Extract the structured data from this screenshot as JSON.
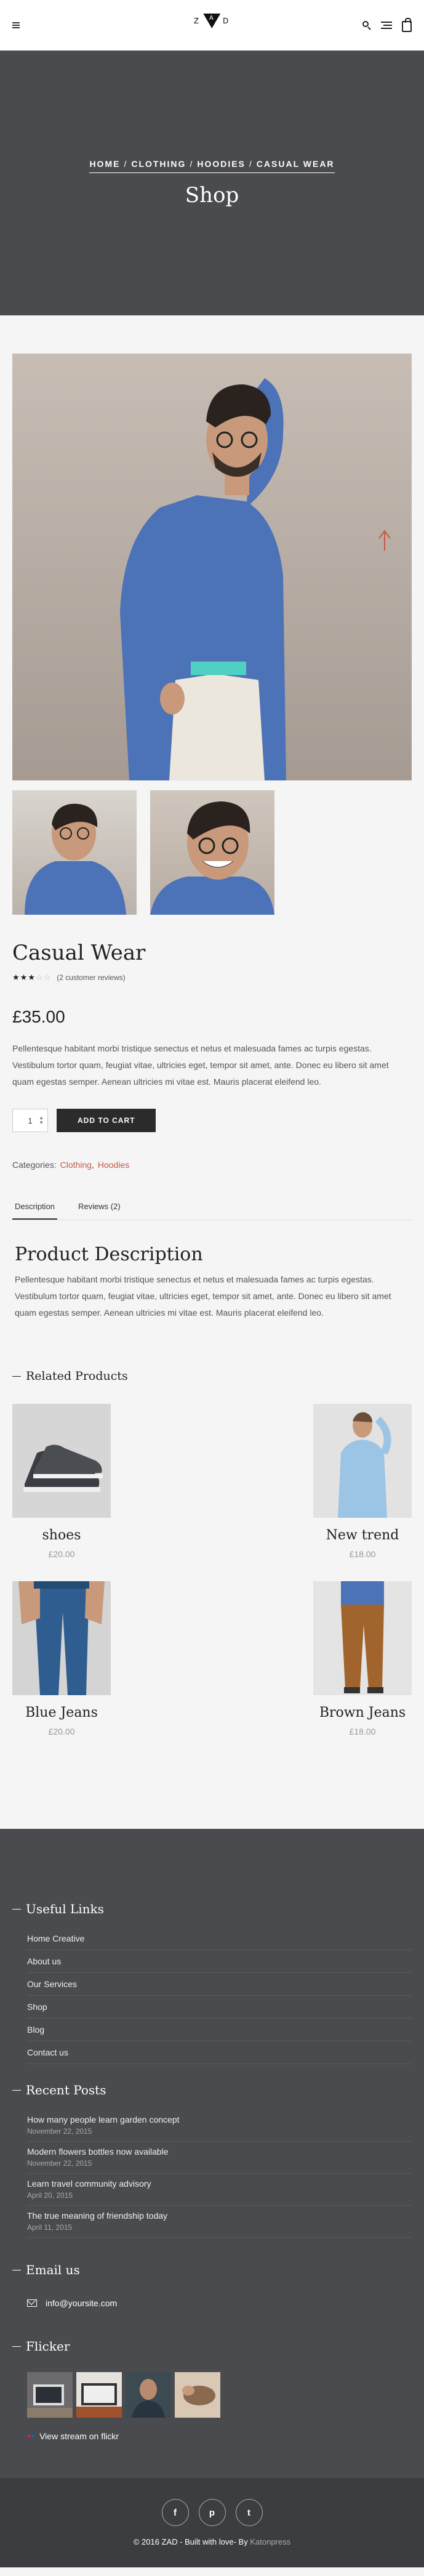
{
  "header": {
    "logo_left": "Z",
    "logo_mid": "A",
    "logo_right": "D"
  },
  "hero": {
    "breadcrumb": [
      "HOME",
      "CLOTHING",
      "HOODIES",
      "CASUAL WEAR"
    ],
    "title": "Shop"
  },
  "product": {
    "title": "Casual Wear",
    "rating": 3,
    "rating_max": 5,
    "reviews": "(2 customer reviews)",
    "price": "£35.00",
    "description": "Pellentesque habitant morbi tristique senectus et netus et malesuada fames ac turpis egestas. Vestibulum tortor quam, feugiat vitae, ultricies eget, tempor sit amet, ante. Donec eu libero sit amet quam egestas semper. Aenean ultricies mi vitae est. Mauris placerat eleifend leo.",
    "quantity": "1",
    "add_to_cart": "ADD TO CART",
    "categories_label": "Categories:",
    "categories": [
      "Clothing",
      "Hoodies"
    ],
    "tabs": [
      "Description",
      "Reviews (2)"
    ],
    "pd_title": "Product Description",
    "pd_text": "Pellentesque habitant morbi tristique senectus et netus et malesuada fames ac turpis egestas. Vestibulum tortor quam, feugiat vitae, ultricies eget, tempor sit amet, ante. Donec eu libero sit amet quam egestas semper. Aenean ultricies mi vitae est. Mauris placerat eleifend leo."
  },
  "related": {
    "title": "Related Products",
    "items": [
      {
        "name": "shoes",
        "price": "£20.00"
      },
      {
        "name": "New trend",
        "price": "£18.00"
      },
      {
        "name": "Blue Jeans",
        "price": "£20.00"
      },
      {
        "name": "Brown Jeans",
        "price": "£18.00"
      }
    ]
  },
  "footer": {
    "useful_links_title": "Useful Links",
    "links": [
      "Home Creative",
      "About us",
      "Our Services",
      "Shop",
      "Blog",
      "Contact us"
    ],
    "recent_posts_title": "Recent Posts",
    "posts": [
      {
        "title": "How many people learn garden concept",
        "date": "November 22, 2015"
      },
      {
        "title": "Modern flowers bottles now available",
        "date": "November 22, 2015"
      },
      {
        "title": "Learn travel community advisory",
        "date": "April 20, 2015"
      },
      {
        "title": "The true meaning of friendship today",
        "date": "April 11, 2015"
      }
    ],
    "email_title": "Email us",
    "email": "info@yoursite.com",
    "flicker_title": "Flicker",
    "flickr_link": "View stream on flickr",
    "social": [
      "f",
      "p",
      "t"
    ],
    "copyright_prefix": "© 2016 ZAD - Built with love- By",
    "copyright_author": "Katonpress"
  }
}
